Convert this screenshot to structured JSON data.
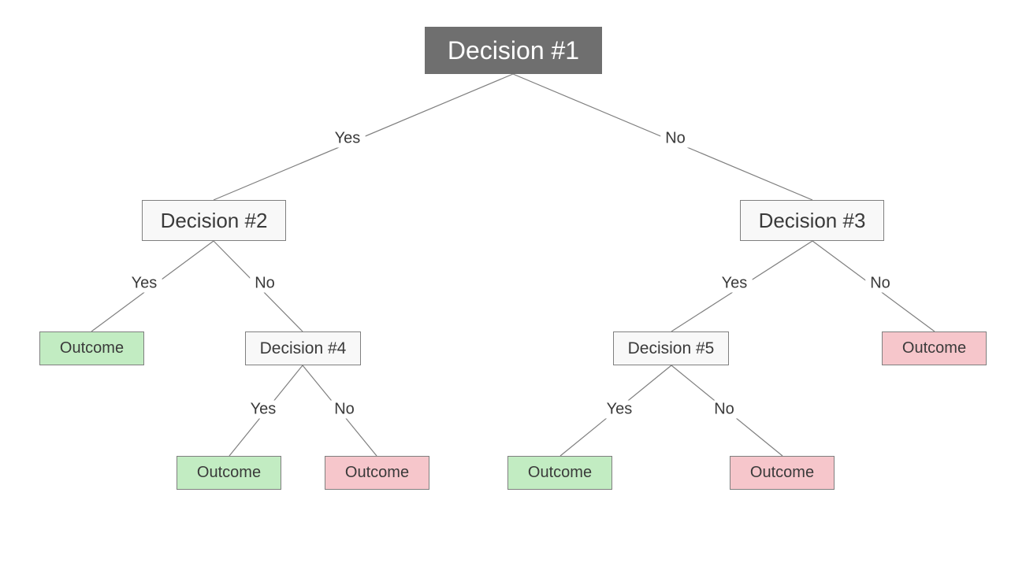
{
  "labels": {
    "yes": "Yes",
    "no": "No",
    "outcome": "Outcome"
  },
  "nodes": {
    "root": "Decision #1",
    "d2": "Decision #2",
    "d3": "Decision #3",
    "d4": "Decision #4",
    "d5": "Decision #5"
  },
  "colors": {
    "good": "#c2ecc2",
    "bad": "#f6c6cb",
    "root_bg": "#6f6f6f",
    "node_border": "#7f7f7f",
    "decision_bg": "#f8f8f8"
  }
}
